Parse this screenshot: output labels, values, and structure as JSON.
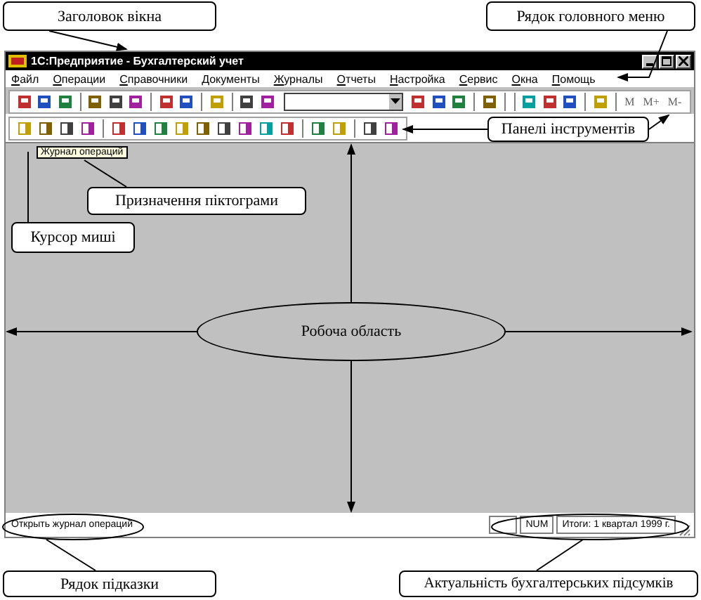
{
  "annotations": {
    "window_title": "Заголовок вікна",
    "main_menu": "Рядок головного меню",
    "toolbars": "Панелі інструментів",
    "icon_purpose": "Призначення піктограми",
    "mouse_cursor": "Курсор миші",
    "work_area": "Робоча область",
    "hint_line": "Рядок підказки",
    "totals": "Актуальність бухгалтерських підсумків"
  },
  "window": {
    "title": "1С:Предприятие - Бухгалтерский учет",
    "menu": [
      "Файл",
      "Операции",
      "Справочники",
      "Документы",
      "Журналы",
      "Отчеты",
      "Настройка",
      "Сервис",
      "Окна",
      "Помощь"
    ],
    "toolbar_buttons": [
      "M",
      "M+",
      "M-"
    ],
    "tooltip": "Журнал операций",
    "status_bar": {
      "hint": "Открыть журнал операций",
      "indicator": "NUM",
      "totals": "Итоги: 1 квартал 1999 г."
    }
  }
}
